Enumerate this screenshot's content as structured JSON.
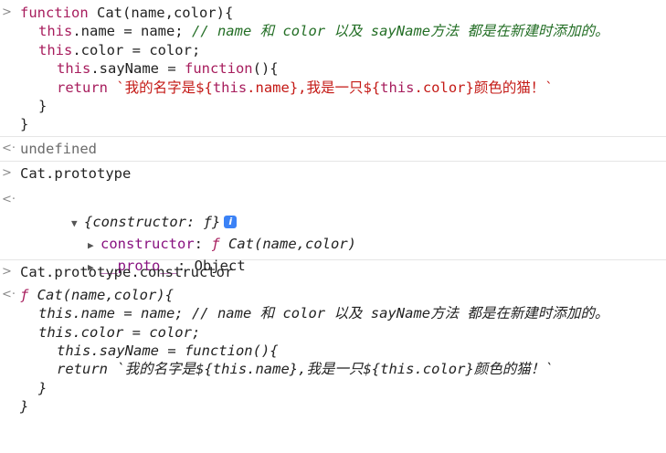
{
  "input1": {
    "line1": "function Cat(name,color){",
    "line2_code": "this.name = name; ",
    "line2_comment": "// name 和 color 以及 sayName方法 都是在新建时添加的。",
    "line3": "this.color = color;",
    "line4": "this.sayName = function(){",
    "line5_kw": "return ",
    "line5_str": "`我的名字是${this.name},我是一只${this.color}颜色的猫！`",
    "line6": "}",
    "line7": "}"
  },
  "output1": {
    "value": "undefined"
  },
  "input2": {
    "code": "Cat.prototype"
  },
  "output2": {
    "summary": "{constructor: ƒ}",
    "info_badge": "i",
    "rows": [
      {
        "key": "constructor",
        "value": "ƒ Cat(name,color)"
      },
      {
        "key": "__proto__",
        "value": "Object"
      }
    ]
  },
  "input3": {
    "code": "Cat.prototype.constructor"
  },
  "output3": {
    "line1": "ƒ Cat(name,color){",
    "line2": "this.name = name; // name 和 color 以及 sayName方法 都是在新建时添加的。",
    "line3": "this.color = color;",
    "line4": "this.sayName = function(){",
    "line5": "return `我的名字是${this.name},我是一只${this.color}颜色的猫！`",
    "line6": "}",
    "line7": "}"
  },
  "prompt_glyph": ">",
  "result_glyph": "<"
}
